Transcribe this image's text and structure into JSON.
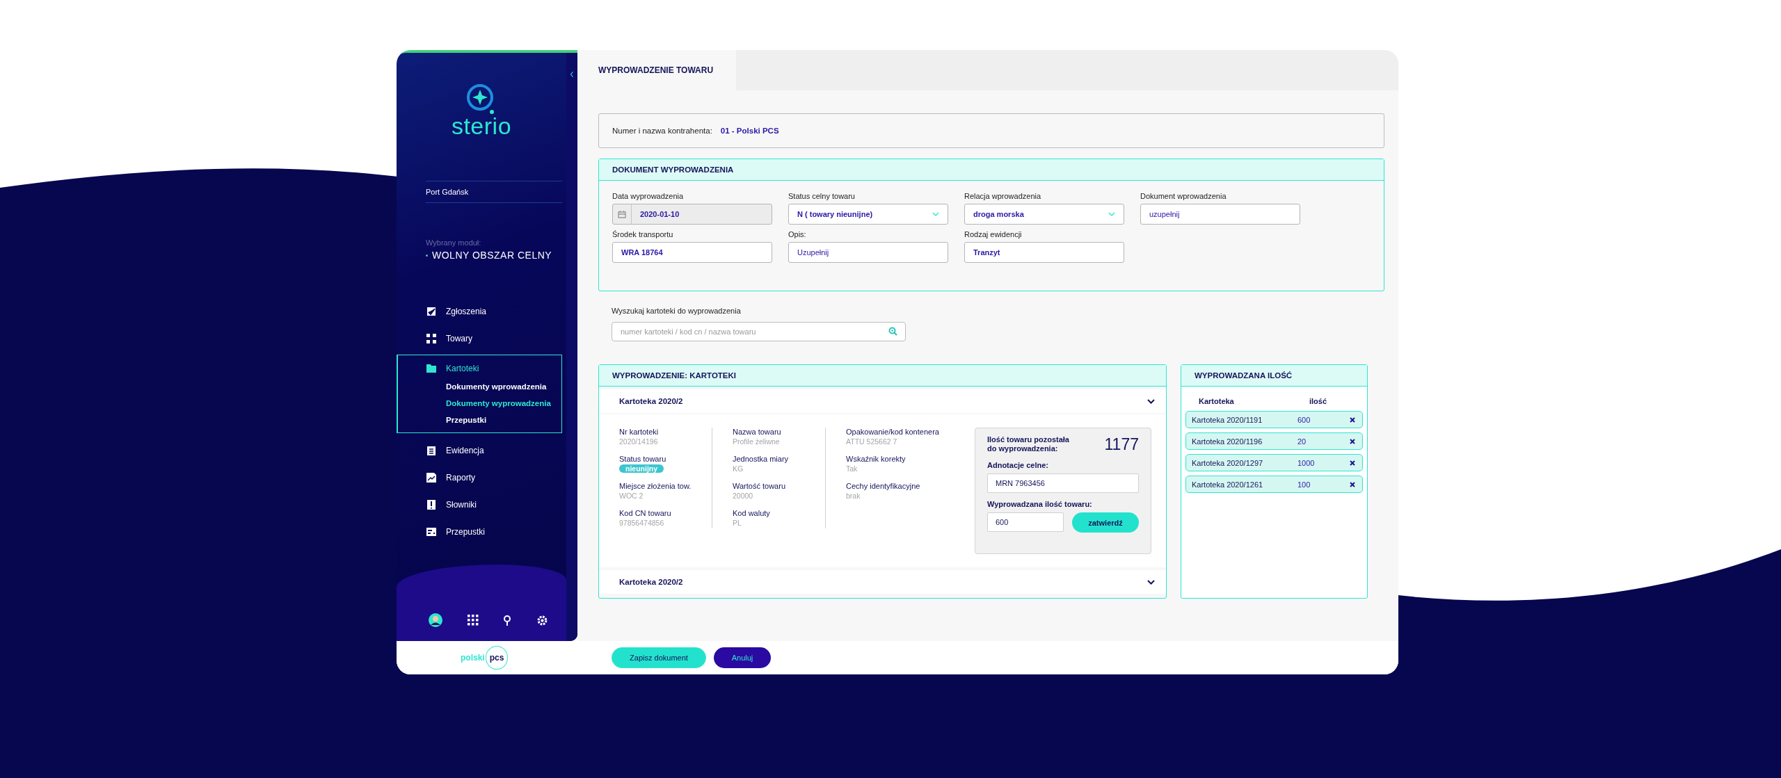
{
  "sidebar": {
    "logo_text": "sterio",
    "location": "Port Gdańsk",
    "module_label": "Wybrany moduł:",
    "module": "WOLNY OBSZAR CELNY",
    "nav": [
      {
        "label": "Zgłoszenia",
        "selected": false
      },
      {
        "label": "Towary",
        "selected": false
      },
      {
        "label": "Kartoteki",
        "selected": true,
        "expanded": true,
        "children": [
          {
            "label": "Dokumenty wprowadzenia",
            "selected": false
          },
          {
            "label": "Dokumenty wyprowadzenia",
            "selected": true
          },
          {
            "label": "Przepustki",
            "selected": false
          }
        ]
      },
      {
        "label": "Ewidencja",
        "selected": false
      },
      {
        "label": "Raporty",
        "selected": false
      },
      {
        "label": "Słowniki",
        "selected": false
      },
      {
        "label": "Przepustki",
        "selected": false
      }
    ]
  },
  "tab": {
    "title": "WYPROWADZENIE TOWARU"
  },
  "contractor": {
    "label": "Numer i nazwa kontrahenta:",
    "value": "01 - Polski PCS"
  },
  "document": {
    "title": "DOKUMENT WYPROWADZENIA",
    "fields": [
      {
        "label": "Data wyprowadzenia",
        "kind": "date",
        "value": "2020-01-10"
      },
      {
        "label": "Status celny towaru",
        "kind": "select",
        "value": "N ( towary nieunijne)"
      },
      {
        "label": "Relacja wprowadzenia",
        "kind": "select",
        "value": "droga morska"
      },
      {
        "label": "Dokument wprowadzenia",
        "kind": "text",
        "placeholder": "uzupełnij"
      },
      {
        "label": "Środek transportu",
        "kind": "text",
        "value": "WRA 18764"
      },
      {
        "label": "Opis:",
        "kind": "text",
        "placeholder": "Uzupełnij"
      },
      {
        "label": "Rodzaj ewidencji",
        "kind": "text",
        "value": "Tranzyt"
      }
    ]
  },
  "search": {
    "label": "Wyszukaj kartoteki do wyprowadzenia",
    "placeholder": "numer kartoteki / kod cn / nazwa towaru"
  },
  "cards": {
    "title": "WYPROWADZENIE: KARTOTEKI",
    "items": [
      {
        "title": "Kartoteka 2020/2",
        "columns": [
          [
            {
              "label": "Nr kartoteki",
              "kind": "text",
              "value": "2020/14196"
            },
            {
              "label": "Status towaru",
              "kind": "badge",
              "value": "nieunijny"
            },
            {
              "label": "Miejsce złożenia tow.",
              "kind": "text",
              "value": "WOC 2"
            },
            {
              "label": "Kod CN towaru",
              "kind": "text",
              "value": "97856474856"
            }
          ],
          [
            {
              "label": "Nazwa towaru",
              "kind": "text",
              "value": "Profile żeliwne"
            },
            {
              "label": "Jednostka miary",
              "kind": "text",
              "value": "KG"
            },
            {
              "label": "Wartość towaru",
              "kind": "text",
              "value": "20000"
            },
            {
              "label": "Kod waluty",
              "kind": "text",
              "value": "PL"
            }
          ],
          [
            {
              "label": "Opakowanie/kod kontenera",
              "kind": "text",
              "value": "ATTU 525662 7"
            },
            {
              "label": "Wskaźnik korekty",
              "kind": "text",
              "value": "Tak"
            },
            {
              "label": "Cechy identyfikacyjne",
              "kind": "text",
              "value": "brak"
            }
          ]
        ],
        "summary": {
          "remaining_label": "Ilość towaru pozostała do wyprowadzenia:",
          "remaining_value": "1177",
          "annotation_label": "Adnotacje celne:",
          "annotation_value": "MRN 7963456",
          "qty_label": "Wyprowadzana ilość towaru:",
          "qty_value": "600",
          "confirm": "zatwierdź"
        }
      },
      {
        "title": "Kartoteka 2020/2"
      }
    ]
  },
  "quantities": {
    "title": "WYPROWADZANA ILOŚĆ",
    "columns": [
      "Kartoteka",
      "ilość"
    ],
    "rows": [
      {
        "name": "Kartoteka 2020/1191",
        "qty": "600"
      },
      {
        "name": "Kartoteka 2020/1196",
        "qty": "20"
      },
      {
        "name": "Kartoteka 2020/1297",
        "qty": "1000"
      },
      {
        "name": "Kartoteka 2020/1261",
        "qty": "100"
      }
    ]
  },
  "footer": {
    "logo_left": "polski",
    "logo_right": "pcs",
    "save": "Zapisz dokument",
    "cancel": "Anuluj"
  }
}
